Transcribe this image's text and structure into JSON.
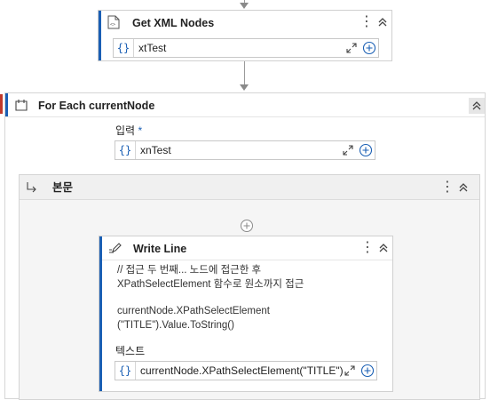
{
  "get_xml_nodes": {
    "title": "Get XML Nodes",
    "field_value": "xtTest",
    "brace": "{}"
  },
  "for_each": {
    "title": "For Each currentNode",
    "input_label": "입력",
    "required_mark": "*",
    "input_value": "xnTest",
    "brace": "{}"
  },
  "body": {
    "title": "본문"
  },
  "write_line": {
    "title": "Write Line",
    "comment_lines": [
      "// 접근 두 번째... 노드에 접근한 후",
      "XPathSelectElement 함수로 원소까지 접근",
      "",
      "currentNode.XPathSelectElement",
      "(\"TITLE\").Value.ToString()"
    ],
    "text_label": "텍스트",
    "text_value": "currentNode.XPathSelectElement(\"TITLE\")",
    "brace": "{}"
  },
  "icons": {
    "kebab": "⋮",
    "colors": {
      "accent": "#1a5fb4",
      "border": "#d0d0d0",
      "body_bg": "#f3f3f3"
    }
  }
}
